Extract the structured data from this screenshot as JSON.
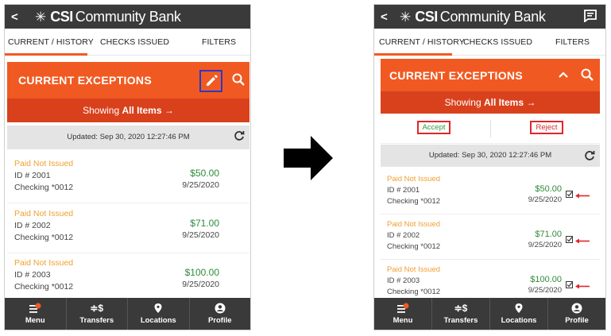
{
  "brand": {
    "csi": "CSI",
    "rest": "Community Bank",
    "back": "<"
  },
  "tabs": {
    "current": "CURRENT / HISTORY",
    "checks": "CHECKS ISSUED",
    "filters": "FILTERS"
  },
  "panel": {
    "title": "CURRENT EXCEPTIONS",
    "showing_prefix": "Showing",
    "showing_bold": "All Items",
    "showing_arrow": "→",
    "updated": "Updated: Sep 30, 2020 12:27:46 PM"
  },
  "actions": {
    "accept": "Accept",
    "reject": "Reject"
  },
  "items": [
    {
      "status": "Paid Not Issued",
      "id": "ID # 2001",
      "account": "Checking *0012",
      "amount": "$50.00",
      "date": "9/25/2020"
    },
    {
      "status": "Paid Not Issued",
      "id": "ID # 2002",
      "account": "Checking *0012",
      "amount": "$71.00",
      "date": "9/25/2020"
    },
    {
      "status": "Paid Not Issued",
      "id": "ID # 2003",
      "account": "Checking *0012",
      "amount": "$100.00",
      "date": "9/25/2020"
    }
  ],
  "nav": [
    {
      "label": "Menu",
      "icon": "menu-icon"
    },
    {
      "label": "Transfers",
      "icon": "transfers-icon"
    },
    {
      "label": "Locations",
      "icon": "location-pin-icon"
    },
    {
      "label": "Profile",
      "icon": "profile-icon"
    }
  ],
  "colors": {
    "accent": "#f05a22",
    "accent_dark": "#d9411d",
    "topbar": "#3a3a3a",
    "amount": "#2e8b3a",
    "status": "#f0a030",
    "highlight_blue": "#2b39c8",
    "highlight_red": "#e0262a"
  }
}
